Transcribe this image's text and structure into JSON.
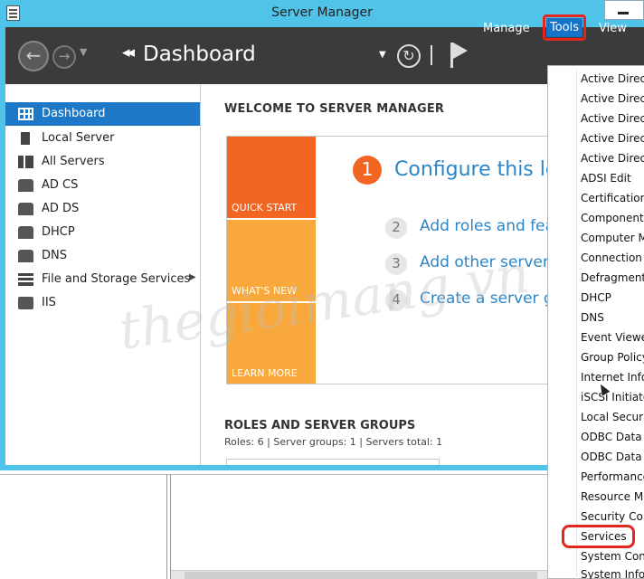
{
  "window": {
    "title": "Server Manager"
  },
  "header": {
    "breadcrumb_glyph": "◂◂",
    "page_title": "Dashboard",
    "menus": {
      "manage": "Manage",
      "tools": "Tools",
      "view": "View"
    }
  },
  "sidebar": {
    "items": [
      {
        "label": "Dashboard",
        "icon": "dashboard-icon",
        "selected": true
      },
      {
        "label": "Local Server",
        "icon": "server-icon"
      },
      {
        "label": "All Servers",
        "icon": "servers-icon"
      },
      {
        "label": "AD CS",
        "icon": "ad-cs-icon"
      },
      {
        "label": "AD DS",
        "icon": "ad-ds-icon"
      },
      {
        "label": "DHCP",
        "icon": "dhcp-icon"
      },
      {
        "label": "DNS",
        "icon": "dns-icon"
      },
      {
        "label": "File and Storage Services",
        "icon": "storage-icon",
        "expandable": true
      },
      {
        "label": "IIS",
        "icon": "iis-icon"
      }
    ]
  },
  "welcome": {
    "heading": "WELCOME TO SERVER MANAGER",
    "tiles": {
      "quick_start": "QUICK START",
      "whats_new": "WHAT'S NEW",
      "learn_more": "LEARN MORE"
    },
    "steps": [
      {
        "number": "1",
        "text": "Configure this loc"
      },
      {
        "number": "2",
        "text": "Add roles and feat"
      },
      {
        "number": "3",
        "text": "Add other servers"
      },
      {
        "number": "4",
        "text": "Create a server gr"
      }
    ]
  },
  "roles": {
    "heading": "ROLES AND SERVER GROUPS",
    "stats": "Roles: 6   |   Server groups: 1   |   Servers total: 1"
  },
  "tools_menu": {
    "items": [
      "Active Directo",
      "Active Directo",
      "Active Directo",
      "Active Directo",
      "Active Directo",
      "ADSI Edit",
      "Certification A",
      "Component S",
      "Computer Ma",
      "Connection M",
      "Defragment a",
      "DHCP",
      "DNS",
      "Event Viewer",
      "Group Policy",
      "Internet Infor",
      "iSCSI Initiator",
      "Local Security",
      "ODBC Data S",
      "ODBC Data S",
      "Performance",
      "Resource Mo",
      "Security Conf",
      "Services",
      "System Confi",
      "System Inform"
    ],
    "highlighted": "Services"
  },
  "watermark": "thegioimang.vn",
  "colors": {
    "titlebar": "#4fc3e8",
    "header": "#3b3b3b",
    "accent": "#1e78c8",
    "orange": "#f26522",
    "highlight_red": "#e5261f"
  }
}
